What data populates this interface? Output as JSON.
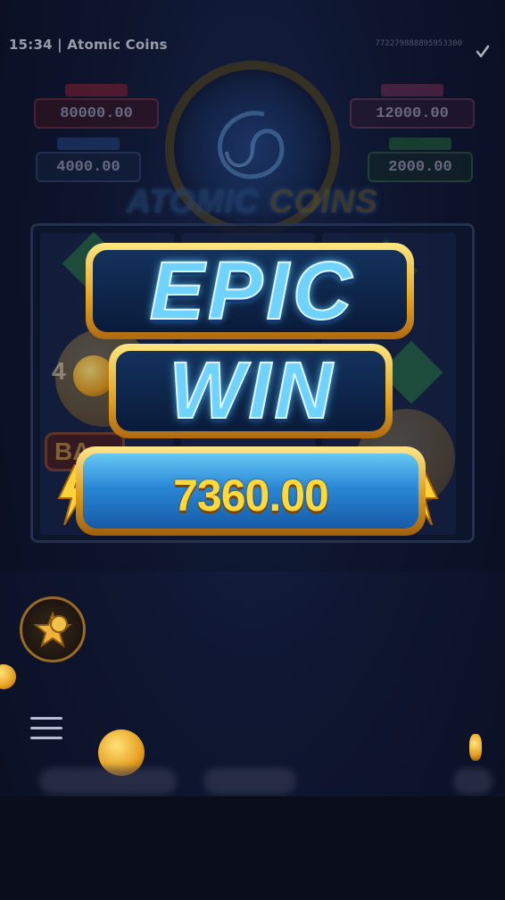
{
  "window": {
    "title": "15:34 | Atomic Coins",
    "session_id": "772279888895953300"
  },
  "jackpots": {
    "grand": {
      "value": "80000.00",
      "color": "#c0283a"
    },
    "major": {
      "value": "12000.00",
      "color": "#a63a6a"
    },
    "minor": {
      "value": "4000.00",
      "color": "#2d5aa8"
    },
    "mini": {
      "value": "2000.00",
      "color": "#2f8a45"
    }
  },
  "logo": {
    "word1": "ATOMIC",
    "word2": "COINS"
  },
  "reels": {
    "bonus_text": "BA",
    "side_number": "4"
  },
  "win": {
    "line1": "EPIC",
    "line2": "WIN",
    "amount": "7360.00"
  },
  "icons": {
    "check": "checkmark-icon",
    "menu": "hamburger-menu-icon",
    "fav": "star-coin-icon",
    "bolt": "lightning-bolt-icon"
  }
}
